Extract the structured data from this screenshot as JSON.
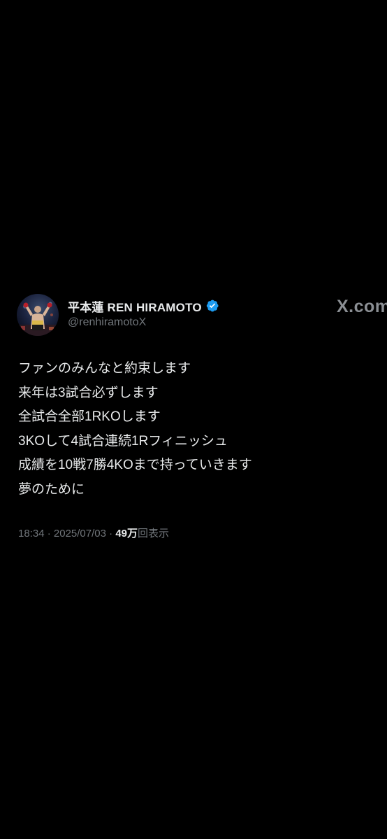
{
  "author": {
    "display_name": "平本蓮 REN HIRAMOTO",
    "handle": "@renhiramotoX",
    "verified": true,
    "verified_color": "#1d9bf0",
    "avatar_icon": "boxer-avatar"
  },
  "brand": {
    "label": "X.com"
  },
  "tweet": {
    "lines": [
      "ファンのみんなと約束します",
      "来年は3試合必ずします",
      "全試合全部1RKOします",
      "3KOして4試合連続1Rフィニッシュ",
      "成績を10戦7勝4KOまで持っていきます",
      "夢のために"
    ]
  },
  "meta": {
    "time": "18:34",
    "separator": " · ",
    "date": "2025/07/03",
    "views_count": "49万",
    "views_label": "回表示"
  },
  "colors": {
    "background": "#000000",
    "primary_text": "#e7e9ea",
    "secondary_text": "#71767b"
  }
}
